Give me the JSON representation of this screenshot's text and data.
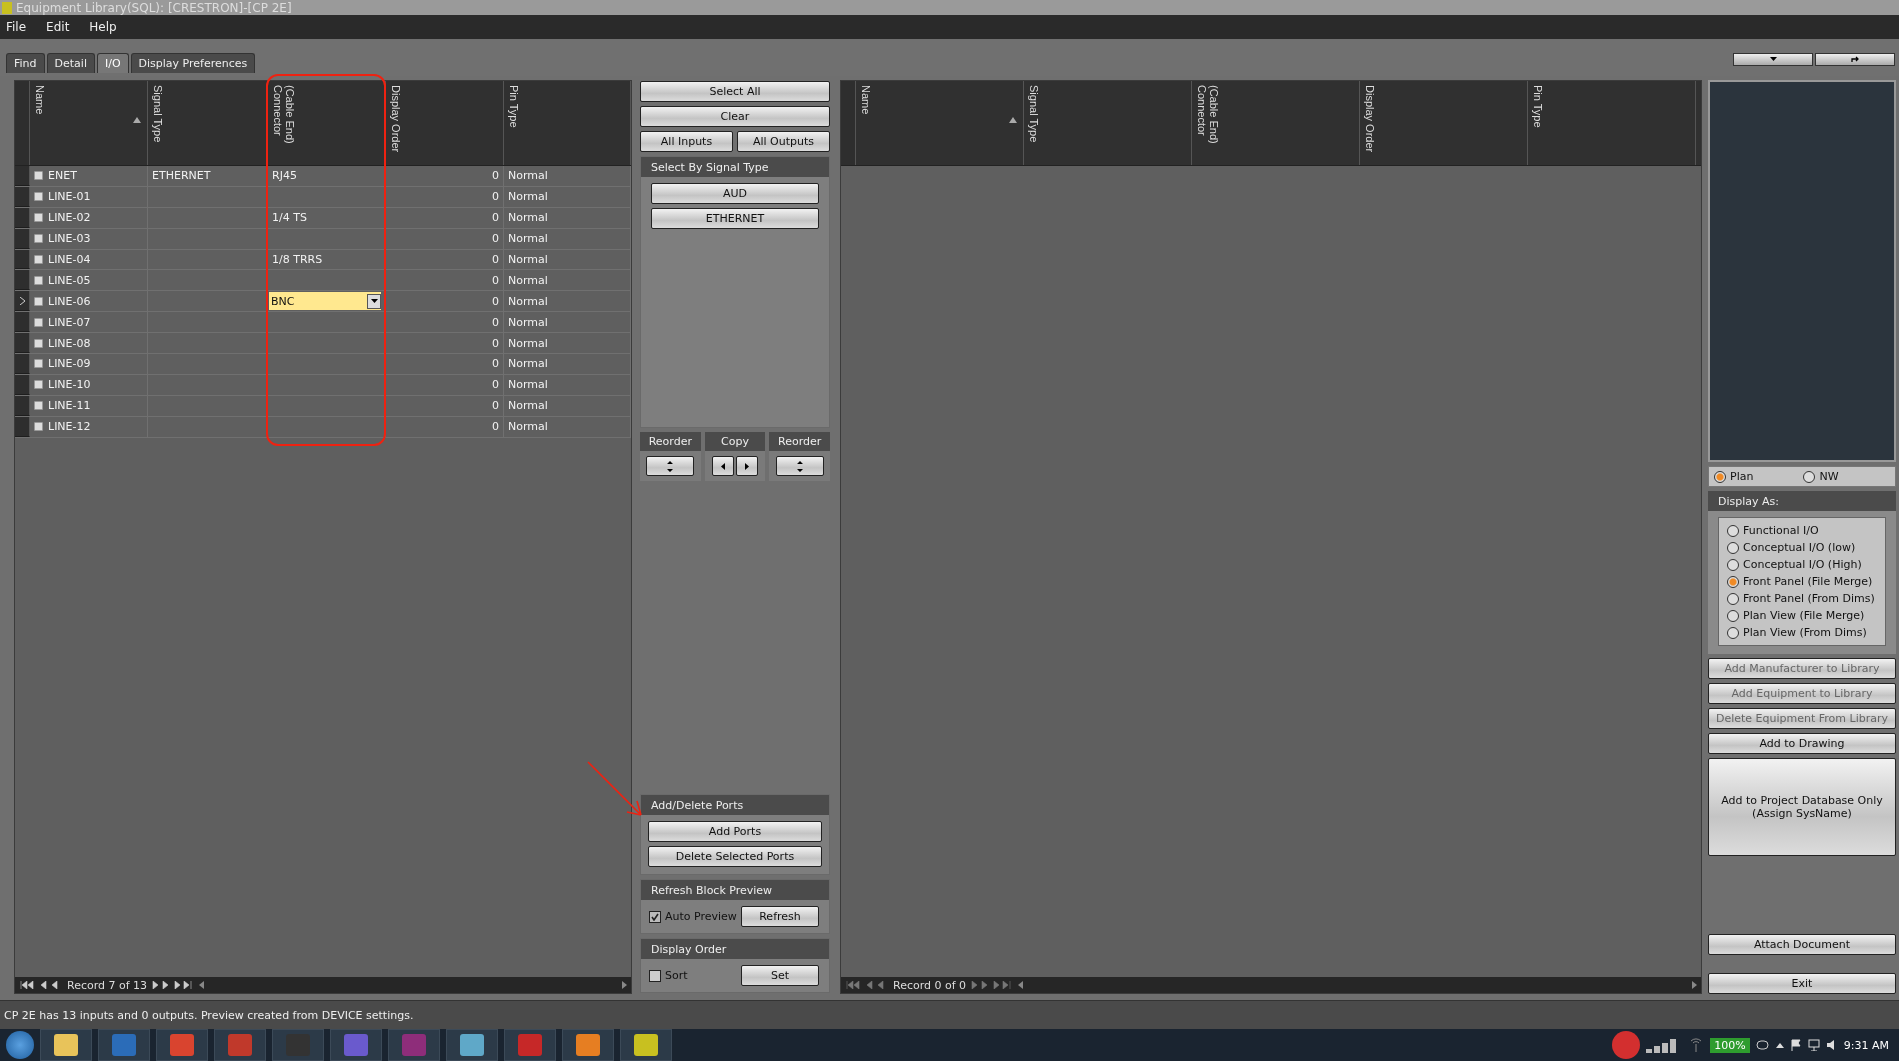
{
  "window": {
    "title": "Equipment Library(SQL): [CRESTRON]-[CP 2E]"
  },
  "menu": [
    "File",
    "Edit",
    "Help"
  ],
  "tabs": [
    {
      "label": "Find",
      "selected": false
    },
    {
      "label": "Detail",
      "selected": false
    },
    {
      "label": "I/O",
      "selected": true
    },
    {
      "label": "Display Preferences",
      "selected": false
    }
  ],
  "left_table": {
    "columns": [
      {
        "label": "Name",
        "sort_ascending": true
      },
      {
        "label": "Signal Type",
        "sort_ascending": false
      },
      {
        "label": "(Cable End) Connector",
        "sort_ascending": false
      },
      {
        "label": "Display Order",
        "sort_ascending": false
      },
      {
        "label": "Pin Type",
        "sort_ascending": false
      }
    ],
    "rows": [
      {
        "name": "ENET",
        "signal_type": "ETHERNET",
        "connector": "RJ45",
        "display_order": "0",
        "pin_type": "Normal",
        "selected": false
      },
      {
        "name": "LINE-01",
        "signal_type": "",
        "connector": "",
        "display_order": "0",
        "pin_type": "Normal",
        "selected": false
      },
      {
        "name": "LINE-02",
        "signal_type": "",
        "connector": "1/4 TS",
        "display_order": "0",
        "pin_type": "Normal",
        "selected": false
      },
      {
        "name": "LINE-03",
        "signal_type": "",
        "connector": "",
        "display_order": "0",
        "pin_type": "Normal",
        "selected": false
      },
      {
        "name": "LINE-04",
        "signal_type": "",
        "connector": "1/8 TRRS",
        "display_order": "0",
        "pin_type": "Normal",
        "selected": false
      },
      {
        "name": "LINE-05",
        "signal_type": "",
        "connector": "",
        "display_order": "0",
        "pin_type": "Normal",
        "selected": false
      },
      {
        "name": "LINE-06",
        "signal_type": "",
        "connector": "BNC",
        "display_order": "0",
        "pin_type": "Normal",
        "selected": true
      },
      {
        "name": "LINE-07",
        "signal_type": "",
        "connector": "",
        "display_order": "0",
        "pin_type": "Normal",
        "selected": false
      },
      {
        "name": "LINE-08",
        "signal_type": "",
        "connector": "",
        "display_order": "0",
        "pin_type": "Normal",
        "selected": false
      },
      {
        "name": "LINE-09",
        "signal_type": "",
        "connector": "",
        "display_order": "0",
        "pin_type": "Normal",
        "selected": false
      },
      {
        "name": "LINE-10",
        "signal_type": "",
        "connector": "",
        "display_order": "0",
        "pin_type": "Normal",
        "selected": false
      },
      {
        "name": "LINE-11",
        "signal_type": "",
        "connector": "",
        "display_order": "0",
        "pin_type": "Normal",
        "selected": false
      },
      {
        "name": "LINE-12",
        "signal_type": "",
        "connector": "",
        "display_order": "0",
        "pin_type": "Normal",
        "selected": false
      }
    ],
    "record": "Record 7 of 13"
  },
  "middle": {
    "top_buttons": [
      "Select All",
      "Clear"
    ],
    "io_buttons": [
      "All Inputs",
      "All Outputs"
    ],
    "signal_section": {
      "title": "Select By Signal Type",
      "buttons": [
        "AUD",
        "ETHERNET"
      ]
    },
    "move_groups": [
      {
        "title": "Reorder",
        "kind": "updown"
      },
      {
        "title": "Copy",
        "kind": "leftright"
      },
      {
        "title": "Reorder",
        "kind": "updown"
      }
    ],
    "ports_section": {
      "title": "Add/Delete Ports",
      "buttons": [
        "Add Ports",
        "Delete Selected Ports"
      ]
    },
    "preview_section": {
      "title": "Refresh Block Preview",
      "checkbox": {
        "label": "Auto Preview",
        "checked": true
      },
      "button": "Refresh"
    },
    "order_section": {
      "title": "Display Order",
      "checkbox": {
        "label": "Sort",
        "checked": false
      },
      "button": "Set"
    }
  },
  "right_table": {
    "columns": [
      {
        "label": "Name",
        "sort_ascending": true
      },
      {
        "label": "Signal Type",
        "sort_ascending": false
      },
      {
        "label": "(Cable End) Connector",
        "sort_ascending": false
      },
      {
        "label": "Display Order",
        "sort_ascending": false
      },
      {
        "label": "Pin Type",
        "sort_ascending": false
      }
    ],
    "record": "Record 0 of 0"
  },
  "side_panel": {
    "view_options": [
      {
        "label": "Plan",
        "selected": true
      },
      {
        "label": "NW",
        "selected": false
      }
    ],
    "display_as": {
      "title": "Display As:",
      "options": [
        {
          "label": "Functional I/O",
          "selected": false
        },
        {
          "label": "Conceptual I/O (low)",
          "selected": false
        },
        {
          "label": "Conceptual I/O (High)",
          "selected": false
        },
        {
          "label": "Front Panel (File Merge)",
          "selected": true
        },
        {
          "label": "Front Panel (From Dims)",
          "selected": false
        },
        {
          "label": "Plan View (File Merge)",
          "selected": false
        },
        {
          "label": "Plan View (From Dims)",
          "selected": false
        }
      ]
    },
    "buttons": [
      {
        "label": "Add Manufacturer to Library",
        "disabled": true
      },
      {
        "label": "Add Equipment to Library",
        "disabled": true
      },
      {
        "label": "Delete Equipment From Library",
        "disabled": true
      },
      {
        "label": "Add to Drawing",
        "disabled": false
      }
    ],
    "database_button": "Add to Project Database Only (Assign SysName)",
    "attach_button": "Attach Document",
    "exit_button": "Exit"
  },
  "status_bar": "CP 2E has 13 inputs and 0 outputs. Preview created from DEVICE settings.",
  "taskbar": {
    "battery": "100%",
    "clock": "9:31 AM"
  }
}
